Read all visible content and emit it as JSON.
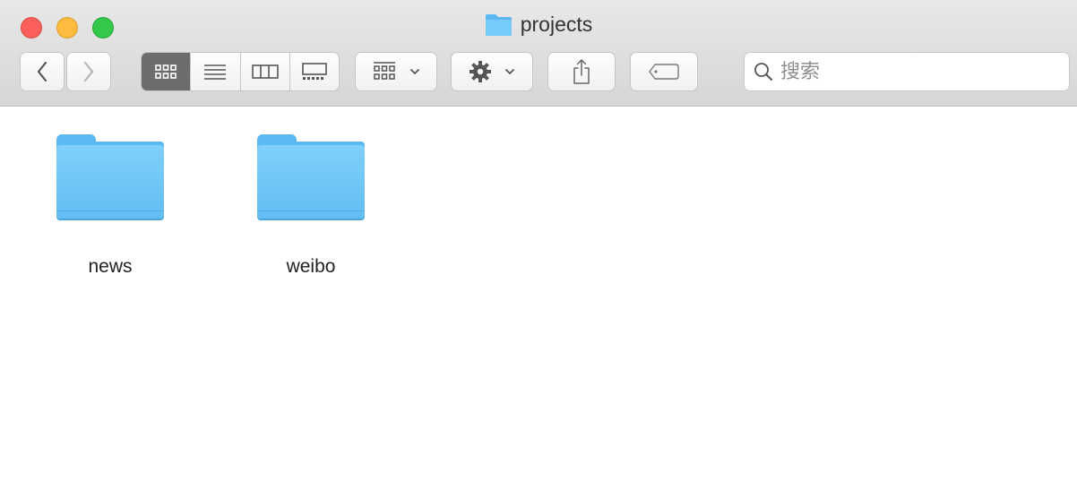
{
  "window": {
    "title": "projects",
    "traffic_lights": {
      "close": "#fc605c",
      "minimize": "#fdbc40",
      "maximize": "#34c84a"
    }
  },
  "toolbar": {
    "back_icon": "chevron-left-icon",
    "forward_icon": "chevron-right-icon",
    "view_modes": [
      {
        "name": "icon-view",
        "active": true
      },
      {
        "name": "list-view",
        "active": false
      },
      {
        "name": "column-view",
        "active": false
      },
      {
        "name": "gallery-view",
        "active": false
      }
    ],
    "arrange_icon": "arrange-grid-icon",
    "action_icon": "gear-icon",
    "share_icon": "share-icon",
    "tag_icon": "tag-icon"
  },
  "search": {
    "placeholder": "搜索",
    "value": ""
  },
  "items": [
    {
      "name": "news",
      "type": "folder"
    },
    {
      "name": "weibo",
      "type": "folder"
    }
  ],
  "colors": {
    "folder": "#6cc4f8",
    "active_segment": "#6c6c6c",
    "toolbar_bg": "#dcdcdc"
  }
}
